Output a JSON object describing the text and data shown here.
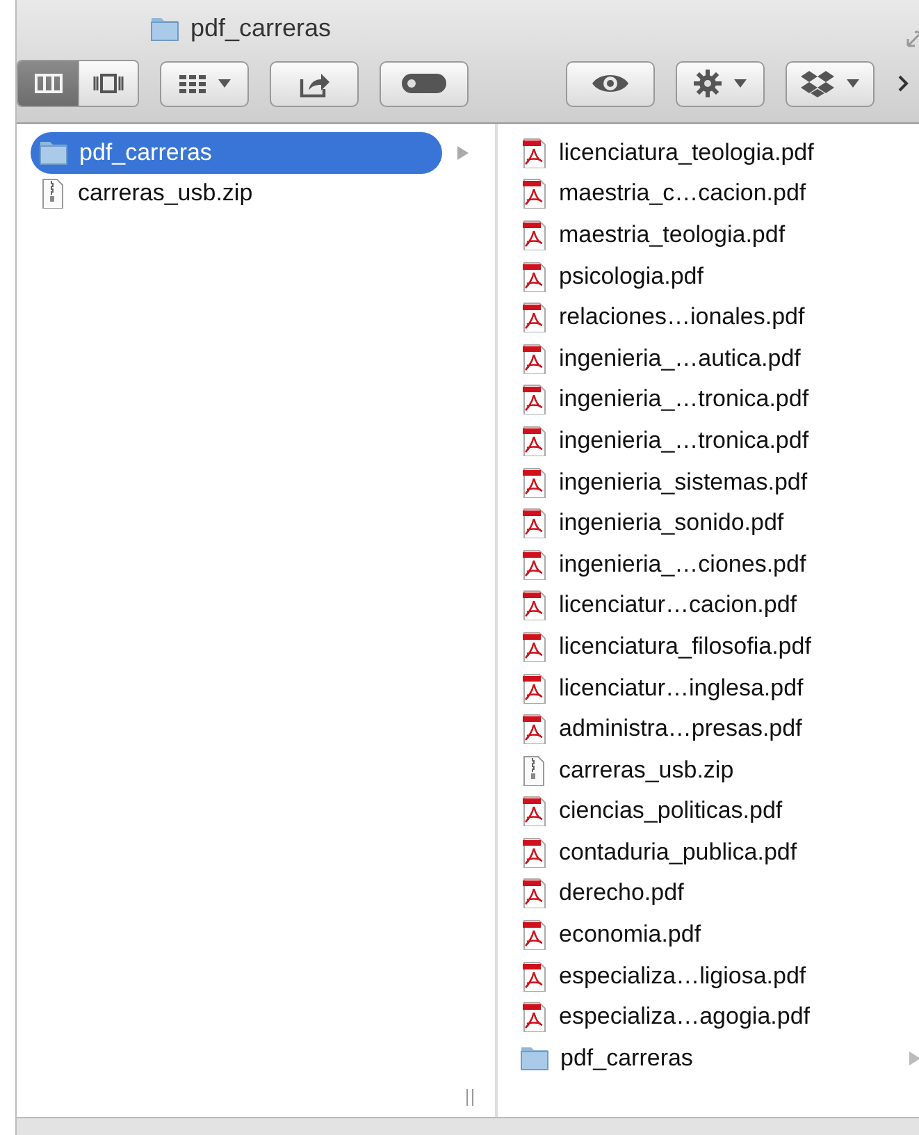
{
  "window": {
    "title": "pdf_carreras"
  },
  "toolbar": [
    {
      "kind": "view-switch",
      "segments": [
        {
          "kind": "columns",
          "selected": true
        },
        {
          "kind": "coverflow",
          "selected": false
        }
      ]
    },
    {
      "kind": "arrange"
    },
    {
      "kind": "share"
    },
    {
      "kind": "tag"
    },
    {
      "kind": "spacer"
    },
    {
      "kind": "quicklook"
    },
    {
      "kind": "action"
    },
    {
      "kind": "dropbox"
    },
    {
      "kind": "overflow"
    }
  ],
  "columns": [
    {
      "items": [
        {
          "name": "pdf_carreras",
          "kind": "folder",
          "selected": true
        },
        {
          "name": "carreras_usb.zip",
          "kind": "zip",
          "selected": false
        }
      ]
    },
    {
      "items": [
        {
          "name": "licenciatura_teologia.pdf",
          "kind": "pdf",
          "selected": false
        },
        {
          "name": "maestria_c…cacion.pdf",
          "kind": "pdf",
          "selected": false
        },
        {
          "name": "maestria_teologia.pdf",
          "kind": "pdf",
          "selected": false
        },
        {
          "name": "psicologia.pdf",
          "kind": "pdf",
          "selected": false
        },
        {
          "name": "relaciones…ionales.pdf",
          "kind": "pdf",
          "selected": false
        },
        {
          "name": "ingenieria_…autica.pdf",
          "kind": "pdf",
          "selected": false
        },
        {
          "name": "ingenieria_…tronica.pdf",
          "kind": "pdf",
          "selected": false
        },
        {
          "name": "ingenieria_…tronica.pdf",
          "kind": "pdf",
          "selected": false
        },
        {
          "name": "ingenieria_sistemas.pdf",
          "kind": "pdf",
          "selected": false
        },
        {
          "name": "ingenieria_sonido.pdf",
          "kind": "pdf",
          "selected": false
        },
        {
          "name": "ingenieria_…ciones.pdf",
          "kind": "pdf",
          "selected": false
        },
        {
          "name": "licenciatur…cacion.pdf",
          "kind": "pdf",
          "selected": false
        },
        {
          "name": "licenciatura_filosofia.pdf",
          "kind": "pdf",
          "selected": false
        },
        {
          "name": "licenciatur…inglesa.pdf",
          "kind": "pdf",
          "selected": false
        },
        {
          "name": "administra…presas.pdf",
          "kind": "pdf",
          "selected": false
        },
        {
          "name": "carreras_usb.zip",
          "kind": "zip",
          "selected": false
        },
        {
          "name": "ciencias_politicas.pdf",
          "kind": "pdf",
          "selected": false
        },
        {
          "name": "contaduria_publica.pdf",
          "kind": "pdf",
          "selected": false
        },
        {
          "name": "derecho.pdf",
          "kind": "pdf",
          "selected": false
        },
        {
          "name": "economia.pdf",
          "kind": "pdf",
          "selected": false
        },
        {
          "name": "especializa…ligiosa.pdf",
          "kind": "pdf",
          "selected": false
        },
        {
          "name": "especializa…agogia.pdf",
          "kind": "pdf",
          "selected": false
        },
        {
          "name": "pdf_carreras",
          "kind": "folder",
          "selected": false
        }
      ]
    }
  ]
}
